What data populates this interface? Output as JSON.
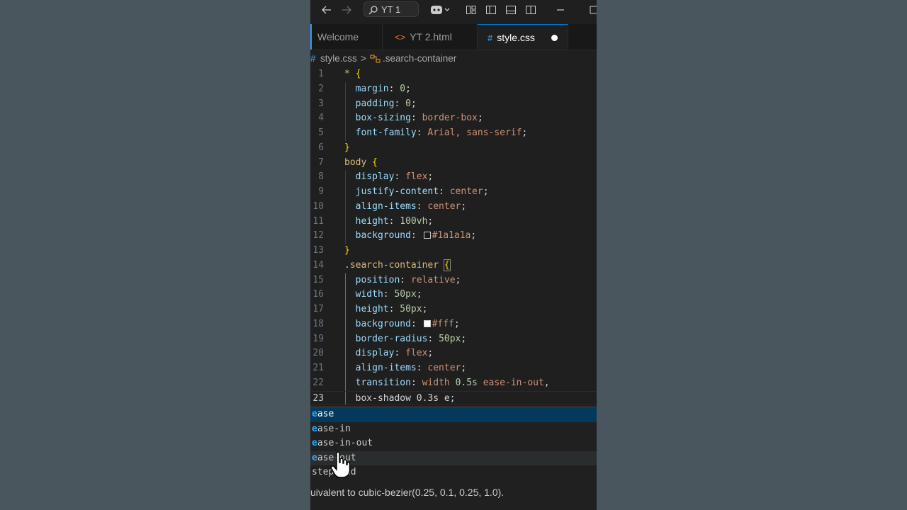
{
  "titlebar": {
    "search_label": "YT 1",
    "icons": [
      "arrow-left-icon",
      "arrow-right-icon",
      "search-icon",
      "copilot-icon",
      "layout-icon",
      "sidebar-toggle-icon",
      "panel-toggle-icon",
      "secondary-sidebar-icon",
      "minimize-icon",
      "maximize-icon"
    ]
  },
  "tabs": [
    {
      "label": "Welcome",
      "icon": ""
    },
    {
      "label": "YT 2.html",
      "icon": "<>"
    },
    {
      "label": "style.css",
      "icon": "#"
    }
  ],
  "breadcrumb": {
    "file": "style.css",
    "symbol": ".search-container"
  },
  "code": {
    "line_numbers": [
      "1",
      "2",
      "3",
      "4",
      "5",
      "6",
      "7",
      "8",
      "9",
      "10",
      "11",
      "12",
      "13",
      "14",
      "15",
      "16",
      "17",
      "18",
      "19",
      "20",
      "21",
      "22",
      "23"
    ],
    "l1_sel": "*",
    "l1_br": "{",
    "l2_p": "margin",
    "l2_v": "0",
    "l3_p": "padding",
    "l3_v": "0",
    "l4_p": "box-sizing",
    "l4_v": "border-box",
    "l5_p": "font-family",
    "l5_v": "Arial, sans-serif",
    "l6_br": "}",
    "l7_sel": "body",
    "l7_br": "{",
    "l8_p": "display",
    "l8_v": "flex",
    "l9_p": "justify-content",
    "l9_v": "center",
    "l10_p": "align-items",
    "l10_v": "center",
    "l11_p": "height",
    "l11_v": "100vh",
    "l12_p": "background",
    "l12_v": "#1a1a1a",
    "l13_br": "}",
    "l14_sel": ".search-container",
    "l14_br": "{",
    "l15_p": "position",
    "l15_v": "relative",
    "l16_p": "width",
    "l16_v": "50px",
    "l17_p": "height",
    "l17_v": "50px",
    "l18_p": "background",
    "l18_v": "#fff",
    "l19_p": "border-radius",
    "l19_v": "50px",
    "l20_p": "display",
    "l20_v": "flex",
    "l21_p": "align-items",
    "l21_v": "center",
    "l22_p": "transition",
    "l22_a": "width",
    "l22_n": "0.5s",
    "l22_v": "ease-in-out",
    "l23_p": "box-shadow",
    "l23_n": "0.3s",
    "l23_v": "e"
  },
  "colors": {
    "swatch_1": "#1a1a1a",
    "swatch_2": "#ffffff",
    "accent": "#0078d4"
  },
  "suggest": {
    "items": [
      {
        "match": "e",
        "rest": "ase"
      },
      {
        "match": "e",
        "rest": "ase-in"
      },
      {
        "match": "e",
        "rest": "ase-in-out"
      },
      {
        "match": "e",
        "rest": "ase-out"
      },
      {
        "match": "",
        "rest": "step-end"
      }
    ],
    "details": "uivalent to cubic-bezier(0.25, 0.1, 0.25, 1.0)."
  }
}
